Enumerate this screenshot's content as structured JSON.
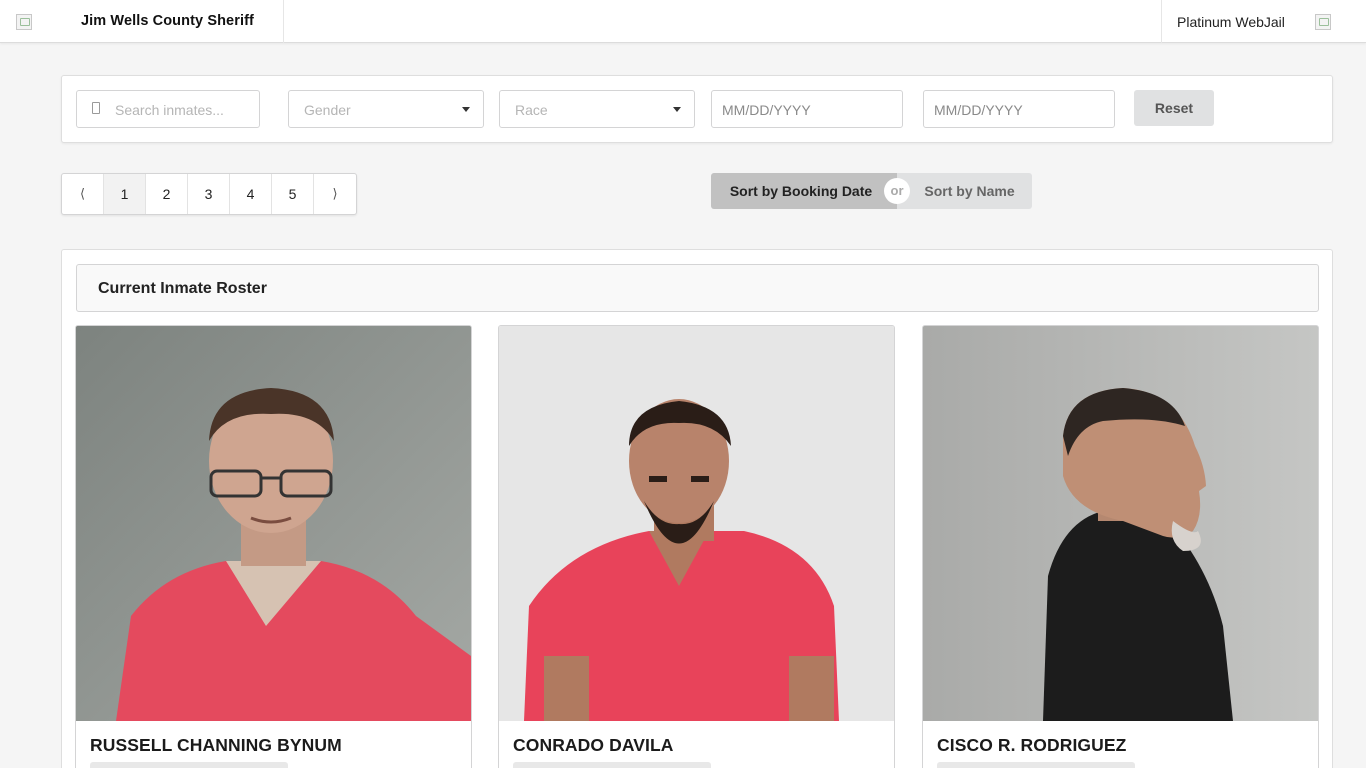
{
  "header": {
    "title": "Jim Wells County Sheriff",
    "brand": "Platinum WebJail"
  },
  "filters": {
    "search_placeholder": "Search inmates...",
    "gender_placeholder": "Gender",
    "race_placeholder": "Race",
    "date_from_placeholder": "MM/DD/YYYY",
    "date_to_placeholder": "MM/DD/YYYY",
    "reset_label": "Reset"
  },
  "pagination": {
    "prev": "⟨",
    "next": "⟩",
    "pages": [
      "1",
      "2",
      "3",
      "4",
      "5"
    ],
    "active_page": "1"
  },
  "sort": {
    "by_booking_label": "Sort by Booking Date",
    "or_label": "or",
    "by_name_label": "Sort by Name",
    "active": "booking_date"
  },
  "roster": {
    "heading": "Current Inmate Roster",
    "inmates": [
      {
        "name": "RUSSELL CHANNING BYNUM",
        "shirt_color": "#e44a5e"
      },
      {
        "name": "CONRADO DAVILA",
        "shirt_color": "#e8435a"
      },
      {
        "name": "CISCO R. RODRIGUEZ",
        "shirt_color": "#1c1c1c"
      }
    ]
  }
}
